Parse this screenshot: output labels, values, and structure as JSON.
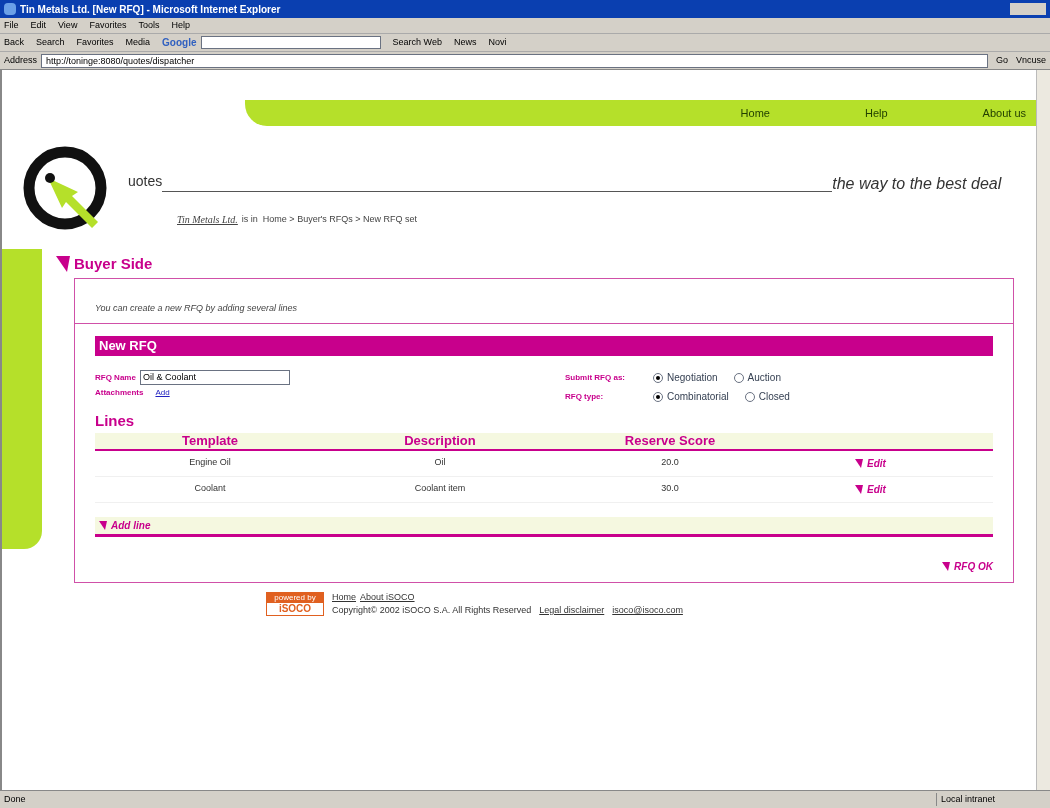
{
  "window": {
    "title": "Tin Metals Ltd. [New RFQ] - Microsoft Internet Explorer"
  },
  "menu": [
    "File",
    "Edit",
    "View",
    "Favorites",
    "Tools",
    "Help"
  ],
  "toolbar": [
    "Back",
    "Search",
    "Favorites",
    "Media",
    "Google",
    "Search Web",
    "News",
    "Novi"
  ],
  "address": {
    "label": "Address",
    "url": "http://toninge:8080/quotes/dispatcher",
    "go": "Go",
    "links": "Vncuse"
  },
  "nav": [
    "Home",
    "Help",
    "About us"
  ],
  "logo": {
    "text": "uotes",
    "tagline": "the way to the best deal"
  },
  "breadcrumb": {
    "company": "Tin Metals Ltd.",
    "rest": "is in  Home > Buyer's RFQs > New RFQ set"
  },
  "section_title": "Buyer Side",
  "intro": "You can create a new RFQ by adding several lines",
  "form": {
    "title": "New RFQ",
    "name_label": "RFQ Name",
    "name_value": "Oil & Coolant",
    "attachments_label": "Attachments",
    "attachments_link": "Add",
    "submit_label": "Submit RFQ as:",
    "submit_options": [
      {
        "label": "Negotiation",
        "selected": true
      },
      {
        "label": "Auction",
        "selected": false
      }
    ],
    "type_label": "RFQ type:",
    "type_options": [
      {
        "label": "Combinatorial",
        "selected": true
      },
      {
        "label": "Closed",
        "selected": false
      }
    ]
  },
  "lines": {
    "title": "Lines",
    "columns": [
      "Template",
      "Description",
      "Reserve Score"
    ],
    "rows": [
      {
        "template": "Engine Oil",
        "description": "Oil",
        "score": "20.0",
        "action": "Edit"
      },
      {
        "template": "Coolant",
        "description": "Coolant item",
        "score": "30.0",
        "action": "Edit"
      }
    ],
    "add": "Add line"
  },
  "ok": "RFQ OK",
  "footer": {
    "badge_top": "powered by",
    "badge": "iSOCO",
    "links": [
      "Home",
      "About iSOCO"
    ],
    "copyright": "Copyright© 2002 iSOCO S.A. All Rights Reserved",
    "disclaimer": "Legal disclaimer",
    "email": "isoco@isoco.com"
  },
  "status": {
    "left": "Done",
    "zone": "Local intranet"
  }
}
